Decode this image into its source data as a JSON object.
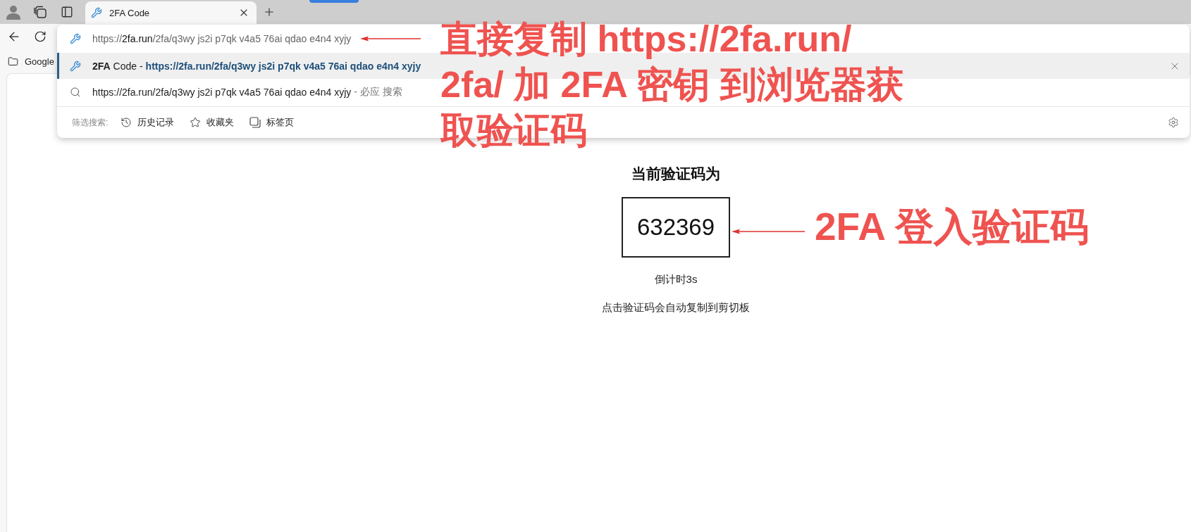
{
  "tab_bar": {
    "tabs": [
      {
        "title": "2FA Code",
        "selected": true
      }
    ]
  },
  "bookmarks_bar": {
    "items": [
      {
        "label": "Google"
      }
    ]
  },
  "address_dropdown": {
    "address": "https://**2fa.run**/2fa/q3wy js2i p7qk v4a5 76ai qdao e4n4 xyjy",
    "suggestions": [
      {
        "kind": "page",
        "title": "**2FA** Code -",
        "url": "https://2fa.run/2fa/q3wy js2i p7qk v4a5 76ai qdao e4n4 xyjy",
        "selected": true
      },
      {
        "kind": "search",
        "query": "https://2fa.run/2fa/q3wy js2i p7qk v4a5 76ai qdao e4n4 xyjy",
        "engine": "- 必应 搜索",
        "selected": false
      }
    ],
    "filter": {
      "label": "筛选搜索:",
      "options": [
        {
          "kind": "history",
          "label": "历史记录"
        },
        {
          "kind": "favorites",
          "label": "收藏夹"
        },
        {
          "kind": "tabs",
          "label": "标签页"
        }
      ]
    }
  },
  "page": {
    "heading": "当前验证码为",
    "code": "632369",
    "countdown": "倒计时3s",
    "hint": "点击验证码会自动复制到剪切板"
  },
  "annotations": [
    {
      "lines": [
        "直接复制 https://2fa.run/",
        "2fa/ 加 2FA 密钥 到浏览器获",
        "取验证码"
      ]
    },
    {
      "lines": [
        "2FA 登入验证码"
      ]
    }
  ]
}
